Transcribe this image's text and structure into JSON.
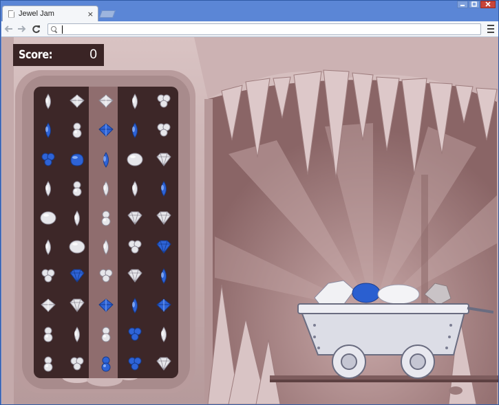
{
  "browser": {
    "tab_title": "Jewel Jam",
    "tab_close": "×",
    "url": "",
    "icons": {
      "back": "back-arrow-icon",
      "forward": "forward-arrow-icon",
      "reload": "reload-icon",
      "menu": "hamburger-menu-icon"
    }
  },
  "game": {
    "title": "Jewel Jam",
    "score_label": "Score:",
    "score_value": "0",
    "colors": {
      "board_bg": "#3d2728",
      "highlight_column": "#8f6d6e",
      "cave_bg": "#c3a8a9",
      "gem_white": "#e6e6ea",
      "gem_blue": "#2e63d6",
      "score_panel": "#3a2425"
    },
    "highlighted_column": 2,
    "grid": [
      [
        "teardrop-white",
        "pyramid-white",
        "pyramid-white",
        "teardrop-white",
        "triangle-cluster-white"
      ],
      [
        "teardrop-blue",
        "sphere-pair-white",
        "pyramid-blue",
        "teardrop-blue",
        "triangle-cluster-white"
      ],
      [
        "triangle-cluster-blue",
        "blob-blue",
        "teardrop-blue",
        "sphere-white",
        "diamond-white"
      ],
      [
        "teardrop-white",
        "sphere-pair-white",
        "teardrop-white",
        "teardrop-white",
        "teardrop-blue"
      ],
      [
        "sphere-white",
        "teardrop-white",
        "sphere-pair-white",
        "diamond-white",
        "diamond-white"
      ],
      [
        "teardrop-white",
        "sphere-white",
        "teardrop-white",
        "triangle-cluster-white",
        "diamond-blue"
      ],
      [
        "triangle-cluster-white",
        "diamond-blue",
        "triangle-cluster-white",
        "diamond-white",
        "teardrop-blue"
      ],
      [
        "pyramid-white",
        "diamond-white",
        "pyramid-blue",
        "teardrop-blue",
        "pyramid-blue"
      ],
      [
        "sphere-pair-white",
        "teardrop-white",
        "sphere-pair-white",
        "triangle-cluster-blue",
        "teardrop-white"
      ],
      [
        "sphere-pair-white",
        "triangle-cluster-white",
        "sphere-pair-blue",
        "triangle-cluster-blue",
        "diamond-white"
      ]
    ]
  }
}
